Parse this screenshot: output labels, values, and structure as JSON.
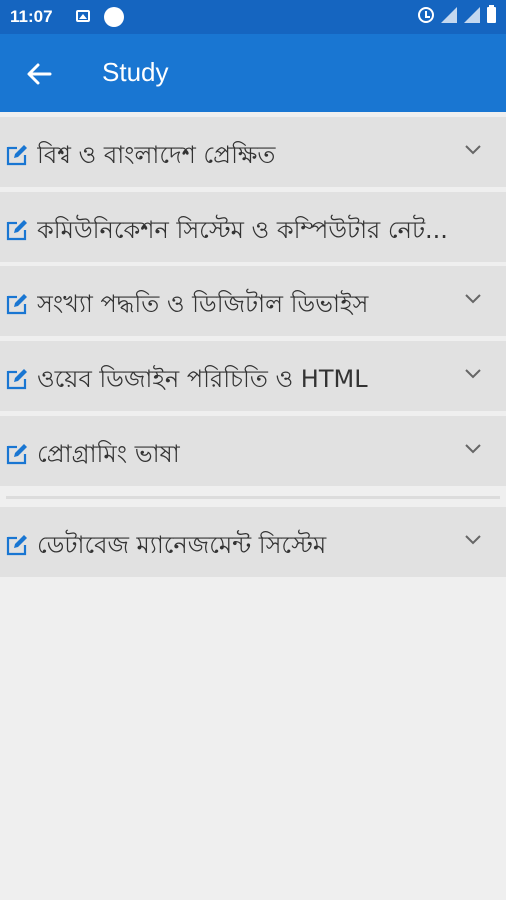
{
  "status": {
    "time": "11:07"
  },
  "header": {
    "title": "Study"
  },
  "topics": [
    {
      "label": "বিশ্ব ও বাংলাদেশ প্রেক্ষিত"
    },
    {
      "label": "কমিউনিকেশন সিস্টেম ও কম্পিউটার নেট..."
    },
    {
      "label": "সংখ্যা পদ্ধতি ও ডিজিটাল ডিভাইস"
    },
    {
      "label": "ওয়েব ডিজাইন পরিচিতি ও HTML"
    },
    {
      "label": "প্রোগ্রামিং ভাষা"
    },
    {
      "label": "ডেটাবেজ ম্যানেজমেন্ট সিস্টেম"
    }
  ],
  "colors": {
    "status_bar": "#1565c0",
    "app_bar": "#1976d2",
    "icon": "#1976d2",
    "item_bg": "#e1e1e1"
  }
}
